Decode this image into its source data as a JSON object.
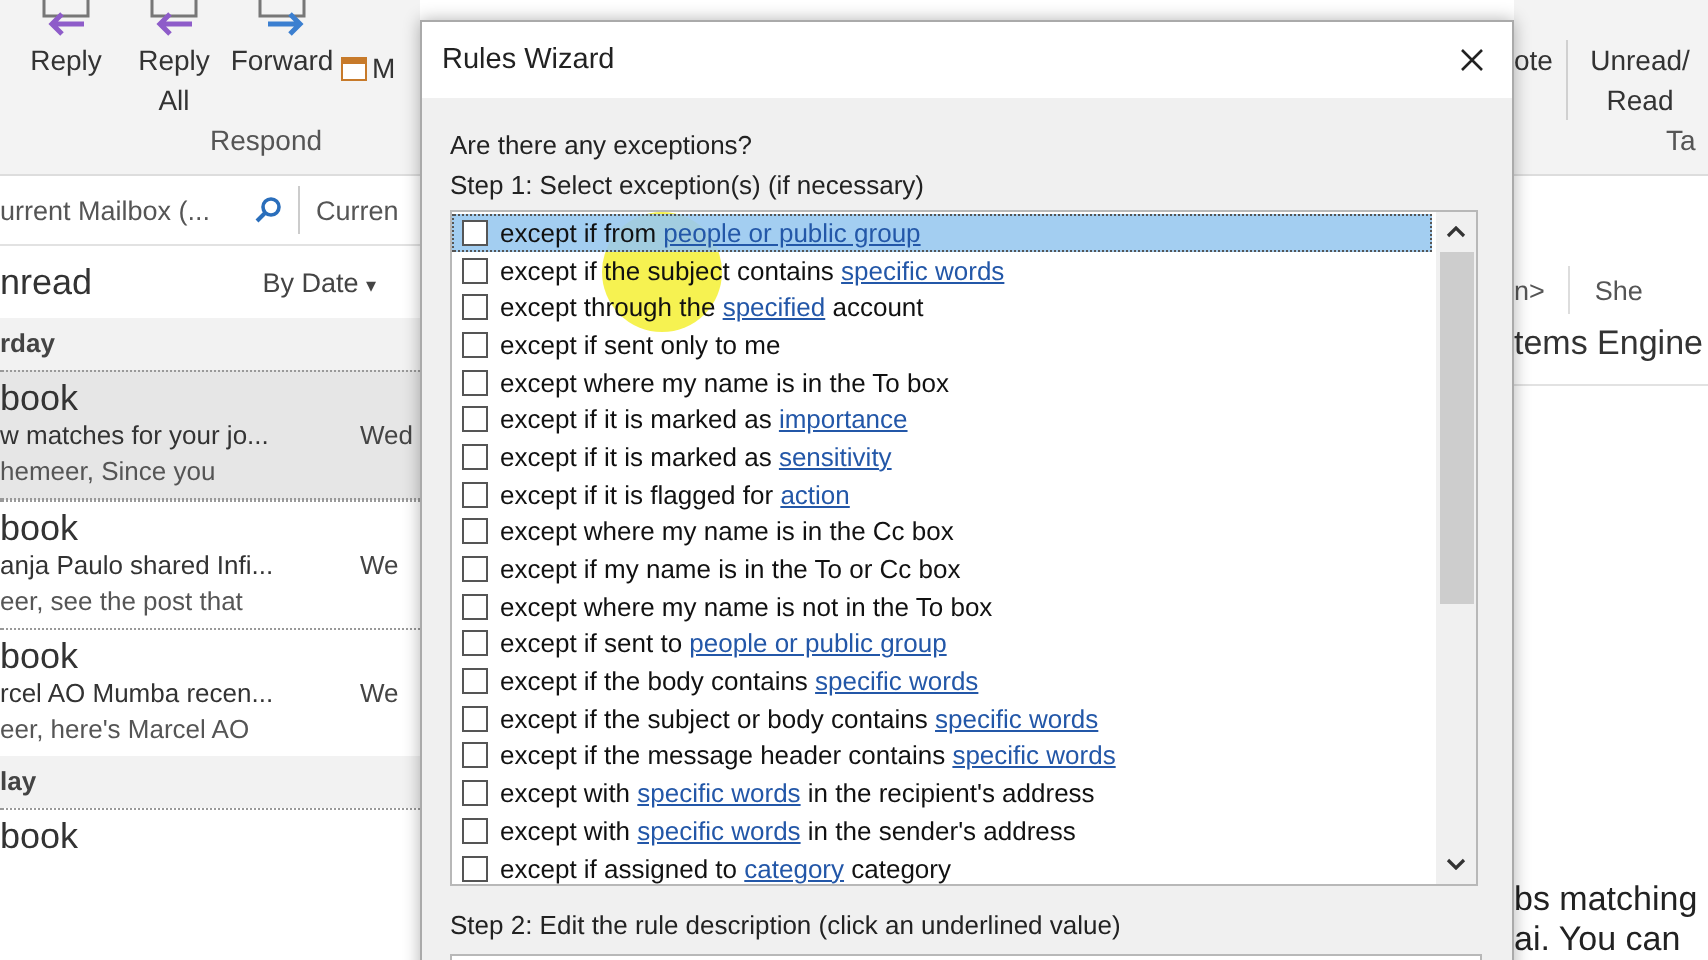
{
  "ribbon": {
    "buttons": [
      {
        "label": "Reply",
        "kind": "reply"
      },
      {
        "label": "Reply All",
        "kind": "replyall"
      },
      {
        "label": "Forward",
        "kind": "forward"
      },
      {
        "label": "M",
        "kind": "meeting"
      }
    ],
    "group_label": "Respond",
    "right_buttons": [
      {
        "label": "ote"
      },
      {
        "label": "Unread/ Read"
      }
    ],
    "right_group_label": "Ta"
  },
  "search": {
    "placeholder": "urrent Mailbox (...",
    "scope": "Curren"
  },
  "mail_list": {
    "filter": "nread",
    "sort": "By Date",
    "sort_caret": "▾",
    "groups": [
      {
        "label": "rday",
        "items": [
          {
            "sender": "book",
            "subject": "w matches for your jo...",
            "date": "Wed",
            "preview": "hemeer,   Since you",
            "selected": true
          },
          {
            "sender": "book",
            "subject": "anja Paulo shared Infi...",
            "date": "We",
            "preview": "eer, see the post that",
            "selected": false
          },
          {
            "sender": "book",
            "subject": "rcel AO Mumba recen...",
            "date": "We",
            "preview": "eer, here's Marcel AO",
            "selected": false
          }
        ]
      },
      {
        "label": "lay",
        "items": [
          {
            "sender": "book",
            "selected": false
          }
        ]
      }
    ]
  },
  "reading_pane": {
    "header_1": "n>",
    "header_2": "She",
    "subject": "tems Engine",
    "body_lines": [
      "bs matching",
      "ai. You can"
    ]
  },
  "dialog": {
    "title": "Rules Wizard",
    "question": "Are there any exceptions?",
    "step1": "Step 1: Select exception(s) (if necessary)",
    "step2": "Step 2: Edit the rule description (click an underlined value)",
    "exceptions": [
      {
        "selected": true,
        "checked": false,
        "segments": [
          {
            "text": "except if from "
          },
          {
            "text": "people or public group",
            "link": true
          }
        ]
      },
      {
        "selected": false,
        "checked": false,
        "segments": [
          {
            "text": "except if the subject contains "
          },
          {
            "text": "specific words",
            "link": true
          }
        ]
      },
      {
        "selected": false,
        "checked": false,
        "segments": [
          {
            "text": "except through the "
          },
          {
            "text": "specified",
            "link": true
          },
          {
            "text": " account"
          }
        ]
      },
      {
        "selected": false,
        "checked": false,
        "segments": [
          {
            "text": "except if sent only to me"
          }
        ]
      },
      {
        "selected": false,
        "checked": false,
        "segments": [
          {
            "text": "except where my name is in the To box"
          }
        ]
      },
      {
        "selected": false,
        "checked": false,
        "segments": [
          {
            "text": "except if it is marked as "
          },
          {
            "text": "importance",
            "link": true
          }
        ]
      },
      {
        "selected": false,
        "checked": false,
        "segments": [
          {
            "text": "except if it is marked as "
          },
          {
            "text": "sensitivity",
            "link": true
          }
        ]
      },
      {
        "selected": false,
        "checked": false,
        "segments": [
          {
            "text": "except if it is flagged for "
          },
          {
            "text": "action",
            "link": true
          }
        ]
      },
      {
        "selected": false,
        "checked": false,
        "segments": [
          {
            "text": "except where my name is in the Cc box"
          }
        ]
      },
      {
        "selected": false,
        "checked": false,
        "segments": [
          {
            "text": "except if my name is in the To or Cc box"
          }
        ]
      },
      {
        "selected": false,
        "checked": false,
        "segments": [
          {
            "text": "except where my name is not in the To box"
          }
        ]
      },
      {
        "selected": false,
        "checked": false,
        "segments": [
          {
            "text": "except if sent to "
          },
          {
            "text": "people or public group",
            "link": true
          }
        ]
      },
      {
        "selected": false,
        "checked": false,
        "segments": [
          {
            "text": "except if the body contains "
          },
          {
            "text": "specific words",
            "link": true
          }
        ]
      },
      {
        "selected": false,
        "checked": false,
        "segments": [
          {
            "text": "except if the subject or body contains "
          },
          {
            "text": "specific words",
            "link": true
          }
        ]
      },
      {
        "selected": false,
        "checked": false,
        "segments": [
          {
            "text": "except if the message header contains "
          },
          {
            "text": "specific words",
            "link": true
          }
        ]
      },
      {
        "selected": false,
        "checked": false,
        "segments": [
          {
            "text": "except with "
          },
          {
            "text": "specific words",
            "link": true
          },
          {
            "text": " in the recipient's address"
          }
        ]
      },
      {
        "selected": false,
        "checked": false,
        "segments": [
          {
            "text": "except with "
          },
          {
            "text": "specific words",
            "link": true
          },
          {
            "text": " in the sender's address"
          }
        ]
      },
      {
        "selected": false,
        "checked": false,
        "segments": [
          {
            "text": "except if assigned to "
          },
          {
            "text": "category",
            "link": true
          },
          {
            "text": " category"
          }
        ]
      }
    ]
  }
}
